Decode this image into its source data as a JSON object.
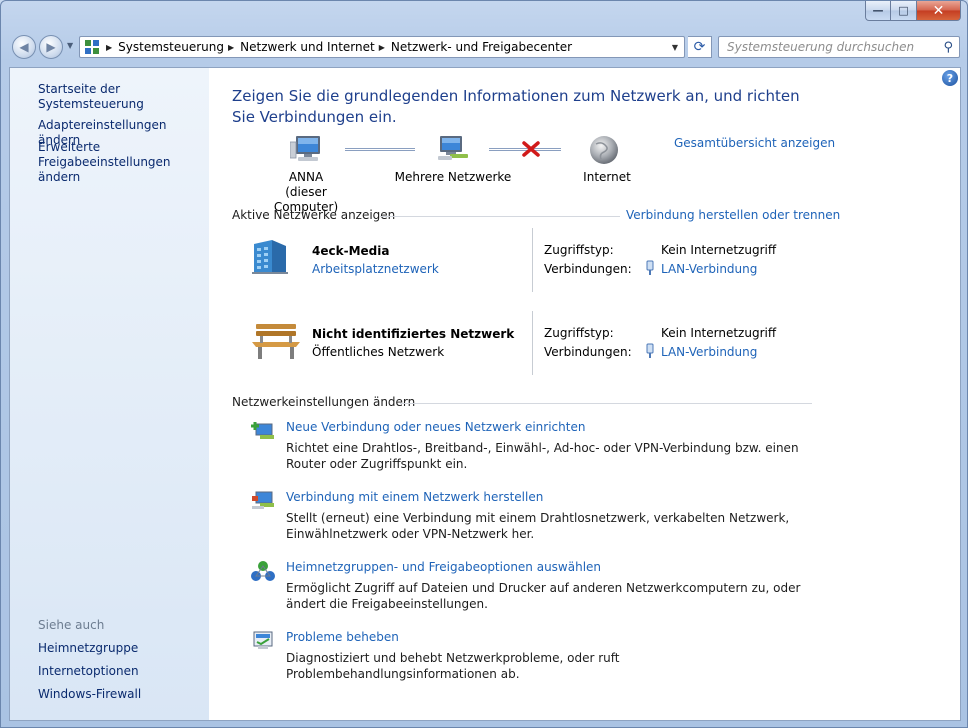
{
  "window": {
    "minimize_glyph": "—",
    "maximize_glyph": "□",
    "close_glyph": "✕"
  },
  "nav": {
    "back_glyph": "◀",
    "forward_glyph": "▶",
    "breadcrumbs": [
      "Systemsteuerung",
      "Netzwerk und Internet",
      "Netzwerk- und Freigabecenter"
    ],
    "search_placeholder": "Systemsteuerung durchsuchen"
  },
  "sidebar": {
    "items": [
      "Startseite der Systemsteuerung",
      "Adaptereinstellungen ändern",
      "Erweiterte Freigabeeinstellungen ändern"
    ],
    "see_also_heading": "Siehe auch",
    "see_also": [
      "Heimnetzgruppe",
      "Internetoptionen",
      "Windows-Firewall"
    ]
  },
  "main": {
    "title": "Zeigen Sie die grundlegenden Informationen zum Netzwerk an, und richten Sie Verbindungen ein.",
    "full_map_link": "Gesamtübersicht anzeigen",
    "map": {
      "computer_name": "ANNA",
      "computer_sub": "(dieser Computer)",
      "network_label": "Mehrere Netzwerke",
      "internet_label": "Internet"
    },
    "active_networks_heading": "Aktive Netzwerke anzeigen",
    "connect_link": "Verbindung herstellen oder trennen",
    "networks": [
      {
        "name": "4eck-Media",
        "type": "Arbeitsplatznetzwerk",
        "access_label": "Zugriffstyp:",
        "access_value": "Kein Internetzugriff",
        "conn_label": "Verbindungen:",
        "conn_value": "LAN-Verbindung"
      },
      {
        "name": "Nicht identifiziertes Netzwerk",
        "type": "Öffentliches Netzwerk",
        "access_label": "Zugriffstyp:",
        "access_value": "Kein Internetzugriff",
        "conn_label": "Verbindungen:",
        "conn_value": "LAN-Verbindung"
      }
    ],
    "settings_heading": "Netzwerkeinstellungen ändern",
    "tasks": [
      {
        "title": "Neue Verbindung oder neues Netzwerk einrichten",
        "desc": "Richtet eine Drahtlos-, Breitband-, Einwähl-, Ad-hoc- oder VPN-Verbindung bzw. einen Router oder Zugriffspunkt ein."
      },
      {
        "title": "Verbindung mit einem Netzwerk herstellen",
        "desc": "Stellt (erneut) eine Verbindung mit einem Drahtlosnetzwerk, verkabelten Netzwerk, Einwählnetzwerk oder VPN-Netzwerk her."
      },
      {
        "title": "Heimnetzgruppen- und Freigabeoptionen auswählen",
        "desc": "Ermöglicht Zugriff auf Dateien und Drucker auf anderen Netzwerkcomputern zu, oder ändert die Freigabeeinstellungen."
      },
      {
        "title": "Probleme beheben",
        "desc": "Diagnostiziert und behebt Netzwerkprobleme, oder ruft Problembehandlungsinformationen ab."
      }
    ]
  },
  "colors": {
    "link": "#1e63b8",
    "title": "#1e3f8c",
    "sidebar_link": "#0a2a6e",
    "error_x": "#d11a1a"
  }
}
